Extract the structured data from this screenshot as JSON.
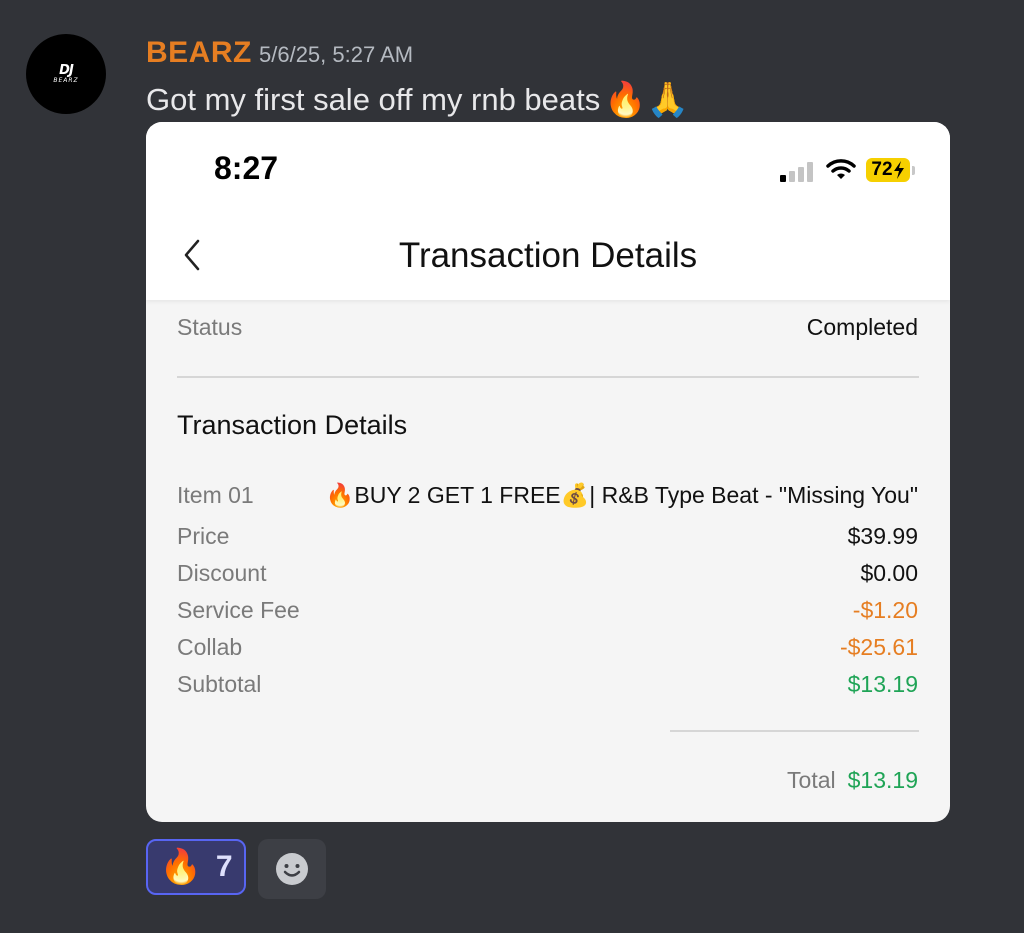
{
  "message": {
    "avatar_text": "DJ",
    "avatar_subtext": "BEARZ",
    "username": "BEARZ",
    "timestamp": "5/6/25, 5:27 AM",
    "text": "Got my first sale off my rnb beats",
    "emoji": "🔥🙏"
  },
  "screenshot": {
    "status_bar": {
      "time": "8:27",
      "battery": "72",
      "signal_icon": "cellular-signal-icon",
      "wifi_icon": "wifi-icon"
    },
    "nav": {
      "back_icon": "chevron-left-icon",
      "title": "Transaction Details"
    },
    "status_row": {
      "label": "Status",
      "value": "Completed"
    },
    "section_title": "Transaction Details",
    "rows": [
      {
        "label": "Item 01",
        "value": "🔥BUY 2 GET 1 FREE💰| R&B Type Beat - \"Missing You\""
      },
      {
        "label": "Price",
        "value": "$39.99"
      },
      {
        "label": "Discount",
        "value": "$0.00"
      },
      {
        "label": "Service Fee",
        "value": "-$1.20"
      },
      {
        "label": "Collab",
        "value": "-$25.61"
      },
      {
        "label": "Subtotal",
        "value": "$13.19"
      }
    ],
    "total": {
      "label": "Total",
      "value": "$13.19"
    },
    "colors": {
      "negative": "#e67e22",
      "positive": "#1fa456"
    }
  },
  "reactions": [
    {
      "emoji": "🔥",
      "count": "7"
    }
  ],
  "add_reaction_icon": "smiley-add-reaction-icon",
  "colors": {
    "background": "#313338",
    "username": "#e67e22",
    "reaction_active": "#5865f2"
  }
}
